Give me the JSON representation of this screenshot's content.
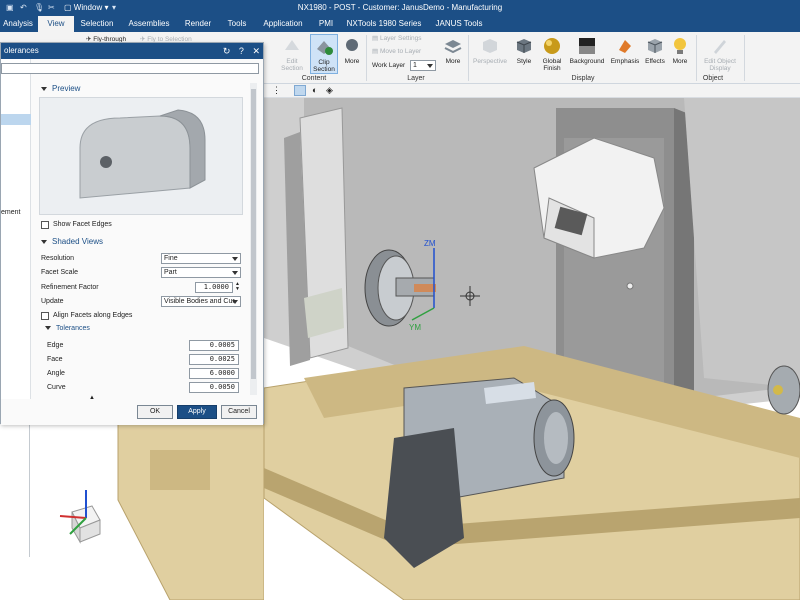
{
  "app": {
    "title": "NX1980 - POST - Customer: JanusDemo - Manufacturing",
    "window_menu": "Window",
    "brand_color": "#1c4f86"
  },
  "menubar": {
    "items": [
      "Analysis",
      "View",
      "Selection",
      "Assemblies",
      "Render",
      "Tools",
      "Application",
      "PMI",
      "NXTools 1980 Series",
      "JANUS Tools"
    ],
    "active": "View"
  },
  "ribbon": {
    "fly_through": "Fly-through",
    "fly_to_selection": "Fly to Selection",
    "clip_section": "Clip Section",
    "more": "More",
    "edit_section": "Edit Section",
    "layer_settings": "Layer Settings",
    "move_to_layer": "Move to Layer",
    "work_layer_label": "Work Layer",
    "work_layer_value": "1",
    "perspective": "Perspective",
    "style": "Style",
    "global_finish": "Global Finish",
    "background": "Background",
    "emphasis": "Emphasis",
    "effects": "Effects",
    "edit_object_display": "Edit Object Display",
    "groups": {
      "content": "Content",
      "layer": "Layer",
      "display": "Display",
      "object": "Object"
    }
  },
  "dialog": {
    "title": "olerances",
    "preview_label": "Preview",
    "show_facet_edges": "Show Facet Edges",
    "shaded_views_label": "Shaded Views",
    "resolution_label": "Resolution",
    "resolution_value": "Fine",
    "facet_scale_label": "Facet Scale",
    "facet_scale_value": "Part",
    "refinement_label": "Refinement Factor",
    "refinement_value": "1.0000",
    "update_label": "Update",
    "update_value": "Visible Bodies and Cur",
    "align_facets": "Align Facets along Edges",
    "tolerances_label": "Tolerances",
    "edge_label": "Edge",
    "edge_value": "0.0005",
    "face_label": "Face",
    "face_value": "0.0025",
    "angle_label": "Angle",
    "angle_value": "6.0000",
    "curve_label": "Curve",
    "curve_value": "0.0050",
    "ok": "OK",
    "apply": "Apply",
    "cancel": "Cancel"
  },
  "left_panel": {
    "fragment": "ement"
  },
  "axes": {
    "zm": "ZM",
    "ym": "YM"
  }
}
